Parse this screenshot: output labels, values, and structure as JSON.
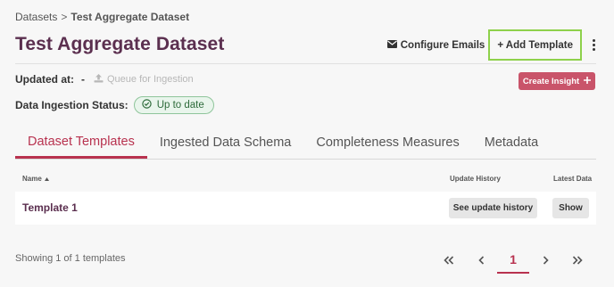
{
  "breadcrumb": {
    "parent": "Datasets",
    "separator": ">",
    "current": "Test Aggregate Dataset"
  },
  "page_title": "Test Aggregate Dataset",
  "actions": {
    "configure_emails": "Configure Emails",
    "add_template": "+ Add Template",
    "icons": {
      "configure_emails": "envelope-icon",
      "more": "kebab-menu-icon"
    }
  },
  "updated": {
    "label": "Updated at:",
    "value": "-",
    "queue_label": "Queue for Ingestion",
    "queue_icon": "upload-icon"
  },
  "create_insight": {
    "label": "Create Insight",
    "icon": "plus-icon"
  },
  "status": {
    "label": "Data Ingestion Status:",
    "badge": "Up to date",
    "badge_icon": "check-circle-icon"
  },
  "tabs": [
    {
      "label": "Dataset Templates",
      "active": true
    },
    {
      "label": "Ingested Data Schema",
      "active": false
    },
    {
      "label": "Completeness Measures",
      "active": false
    },
    {
      "label": "Metadata",
      "active": false
    }
  ],
  "table": {
    "columns": {
      "name": "Name",
      "update_history": "Update History",
      "latest_data": "Latest Data"
    },
    "rows": [
      {
        "name": "Template 1",
        "history_button": "See update history",
        "latest_button": "Show"
      }
    ]
  },
  "footer": {
    "showing": "Showing 1 of 1 templates",
    "current_page": "1"
  },
  "colors": {
    "title": "#5b2f4f",
    "accent": "#b8324f",
    "create_insight_bg": "#c9546a",
    "highlight_border": "#8ed14b",
    "status_green": "#8fc59b"
  }
}
